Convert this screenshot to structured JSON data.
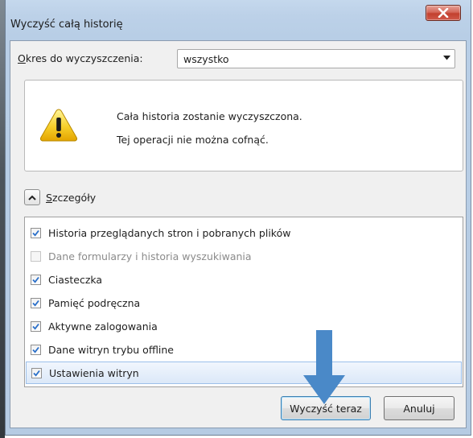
{
  "window": {
    "title": "Wyczyść całą historię"
  },
  "okres": {
    "label": "Okres do wyczyszczenia:",
    "selected": "wszystko"
  },
  "warning": {
    "line1": "Cała historia zostanie wyczyszczona.",
    "line2": "Tej operacji nie można cofnąć."
  },
  "details": {
    "label": "Szczegóły"
  },
  "items": [
    {
      "label": "Historia przeglądanych stron i pobranych plików",
      "checked": true,
      "enabled": true
    },
    {
      "label": "Dane formularzy i historia wyszukiwania",
      "checked": false,
      "enabled": false
    },
    {
      "label": "Ciasteczka",
      "checked": true,
      "enabled": true
    },
    {
      "label": "Pamięć podręczna",
      "checked": true,
      "enabled": true
    },
    {
      "label": "Aktywne zalogowania",
      "checked": true,
      "enabled": true
    },
    {
      "label": "Dane witryn trybu offline",
      "checked": true,
      "enabled": true
    },
    {
      "label": "Ustawienia witryn",
      "checked": true,
      "enabled": true
    }
  ],
  "buttons": {
    "clear": "Wyczyść teraz",
    "cancel": "Anuluj"
  },
  "colors": {
    "check": "#2a6fc9",
    "arrow": "#4a89c8"
  }
}
